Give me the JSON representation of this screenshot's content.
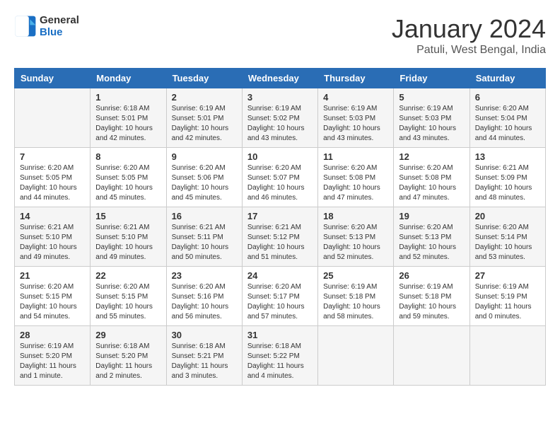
{
  "header": {
    "logo_line1": "General",
    "logo_line2": "Blue",
    "month": "January 2024",
    "location": "Patuli, West Bengal, India"
  },
  "weekdays": [
    "Sunday",
    "Monday",
    "Tuesday",
    "Wednesday",
    "Thursday",
    "Friday",
    "Saturday"
  ],
  "weeks": [
    [
      {
        "day": "",
        "info": ""
      },
      {
        "day": "1",
        "info": "Sunrise: 6:18 AM\nSunset: 5:01 PM\nDaylight: 10 hours\nand 42 minutes."
      },
      {
        "day": "2",
        "info": "Sunrise: 6:19 AM\nSunset: 5:01 PM\nDaylight: 10 hours\nand 42 minutes."
      },
      {
        "day": "3",
        "info": "Sunrise: 6:19 AM\nSunset: 5:02 PM\nDaylight: 10 hours\nand 43 minutes."
      },
      {
        "day": "4",
        "info": "Sunrise: 6:19 AM\nSunset: 5:03 PM\nDaylight: 10 hours\nand 43 minutes."
      },
      {
        "day": "5",
        "info": "Sunrise: 6:19 AM\nSunset: 5:03 PM\nDaylight: 10 hours\nand 43 minutes."
      },
      {
        "day": "6",
        "info": "Sunrise: 6:20 AM\nSunset: 5:04 PM\nDaylight: 10 hours\nand 44 minutes."
      }
    ],
    [
      {
        "day": "7",
        "info": "Sunrise: 6:20 AM\nSunset: 5:05 PM\nDaylight: 10 hours\nand 44 minutes."
      },
      {
        "day": "8",
        "info": "Sunrise: 6:20 AM\nSunset: 5:05 PM\nDaylight: 10 hours\nand 45 minutes."
      },
      {
        "day": "9",
        "info": "Sunrise: 6:20 AM\nSunset: 5:06 PM\nDaylight: 10 hours\nand 45 minutes."
      },
      {
        "day": "10",
        "info": "Sunrise: 6:20 AM\nSunset: 5:07 PM\nDaylight: 10 hours\nand 46 minutes."
      },
      {
        "day": "11",
        "info": "Sunrise: 6:20 AM\nSunset: 5:08 PM\nDaylight: 10 hours\nand 47 minutes."
      },
      {
        "day": "12",
        "info": "Sunrise: 6:20 AM\nSunset: 5:08 PM\nDaylight: 10 hours\nand 47 minutes."
      },
      {
        "day": "13",
        "info": "Sunrise: 6:21 AM\nSunset: 5:09 PM\nDaylight: 10 hours\nand 48 minutes."
      }
    ],
    [
      {
        "day": "14",
        "info": "Sunrise: 6:21 AM\nSunset: 5:10 PM\nDaylight: 10 hours\nand 49 minutes."
      },
      {
        "day": "15",
        "info": "Sunrise: 6:21 AM\nSunset: 5:10 PM\nDaylight: 10 hours\nand 49 minutes."
      },
      {
        "day": "16",
        "info": "Sunrise: 6:21 AM\nSunset: 5:11 PM\nDaylight: 10 hours\nand 50 minutes."
      },
      {
        "day": "17",
        "info": "Sunrise: 6:21 AM\nSunset: 5:12 PM\nDaylight: 10 hours\nand 51 minutes."
      },
      {
        "day": "18",
        "info": "Sunrise: 6:20 AM\nSunset: 5:13 PM\nDaylight: 10 hours\nand 52 minutes."
      },
      {
        "day": "19",
        "info": "Sunrise: 6:20 AM\nSunset: 5:13 PM\nDaylight: 10 hours\nand 52 minutes."
      },
      {
        "day": "20",
        "info": "Sunrise: 6:20 AM\nSunset: 5:14 PM\nDaylight: 10 hours\nand 53 minutes."
      }
    ],
    [
      {
        "day": "21",
        "info": "Sunrise: 6:20 AM\nSunset: 5:15 PM\nDaylight: 10 hours\nand 54 minutes."
      },
      {
        "day": "22",
        "info": "Sunrise: 6:20 AM\nSunset: 5:15 PM\nDaylight: 10 hours\nand 55 minutes."
      },
      {
        "day": "23",
        "info": "Sunrise: 6:20 AM\nSunset: 5:16 PM\nDaylight: 10 hours\nand 56 minutes."
      },
      {
        "day": "24",
        "info": "Sunrise: 6:20 AM\nSunset: 5:17 PM\nDaylight: 10 hours\nand 57 minutes."
      },
      {
        "day": "25",
        "info": "Sunrise: 6:19 AM\nSunset: 5:18 PM\nDaylight: 10 hours\nand 58 minutes."
      },
      {
        "day": "26",
        "info": "Sunrise: 6:19 AM\nSunset: 5:18 PM\nDaylight: 10 hours\nand 59 minutes."
      },
      {
        "day": "27",
        "info": "Sunrise: 6:19 AM\nSunset: 5:19 PM\nDaylight: 11 hours\nand 0 minutes."
      }
    ],
    [
      {
        "day": "28",
        "info": "Sunrise: 6:19 AM\nSunset: 5:20 PM\nDaylight: 11 hours\nand 1 minute."
      },
      {
        "day": "29",
        "info": "Sunrise: 6:18 AM\nSunset: 5:20 PM\nDaylight: 11 hours\nand 2 minutes."
      },
      {
        "day": "30",
        "info": "Sunrise: 6:18 AM\nSunset: 5:21 PM\nDaylight: 11 hours\nand 3 minutes."
      },
      {
        "day": "31",
        "info": "Sunrise: 6:18 AM\nSunset: 5:22 PM\nDaylight: 11 hours\nand 4 minutes."
      },
      {
        "day": "",
        "info": ""
      },
      {
        "day": "",
        "info": ""
      },
      {
        "day": "",
        "info": ""
      }
    ]
  ]
}
